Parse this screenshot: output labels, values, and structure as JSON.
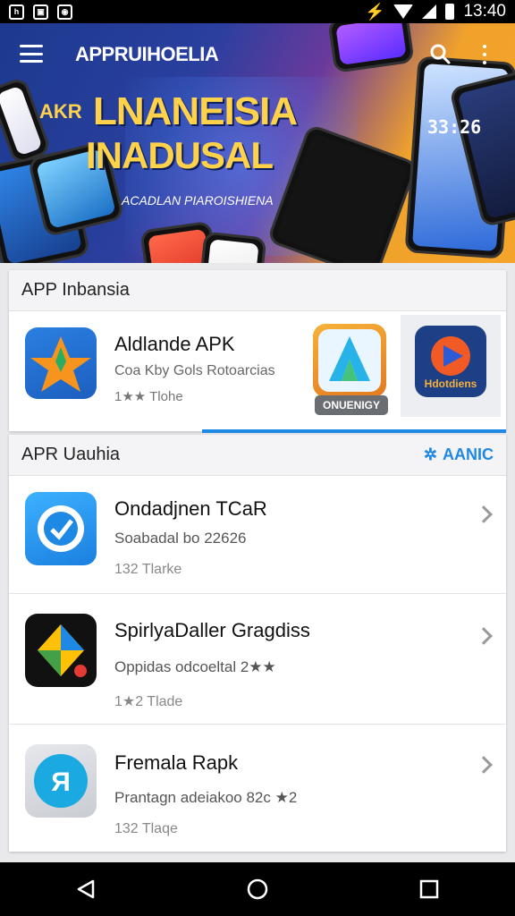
{
  "status_bar": {
    "time": "13:40"
  },
  "hero": {
    "app_title": "APPRUIHOELIA",
    "tagline_small": "AKR",
    "headline_line1": "LNANEISIA",
    "headline_line2": "INADUSAL",
    "subline": "ACADLAN PIAROISHIENA",
    "phone_time": "33:26"
  },
  "featured": {
    "section_title": "APP Inbansia",
    "app_title": "Aldlande APK",
    "app_subtitle": "Coa Kby Gols Rotoarcias",
    "app_rating": "1★★ Tlohe",
    "tile_badge": "ONUENIGY",
    "tile2_label": "Hdotdiens"
  },
  "list_section": {
    "section_title": "APR Uauhia",
    "see_all_label": "AANIC",
    "items": [
      {
        "title": "Ondadjnen TCaR",
        "subtitle": "Soabadal bo 22626",
        "meta": "132 Tlarke",
        "icon": "shield-clock-icon"
      },
      {
        "title": "SpirlyaDaller Gragdiss",
        "subtitle": "Oppidas odcoeltal 2★★",
        "meta": "1★2 Tlade",
        "icon": "diamond-logo-icon"
      },
      {
        "title": "Fremala Rapk",
        "subtitle": "Prantagn adeiakoo 82c ★2",
        "meta": "132 Tlaqe",
        "icon": "rn-logo-icon"
      }
    ]
  },
  "colors": {
    "accent": "#1e88e5",
    "headline": "#ffd24a"
  }
}
